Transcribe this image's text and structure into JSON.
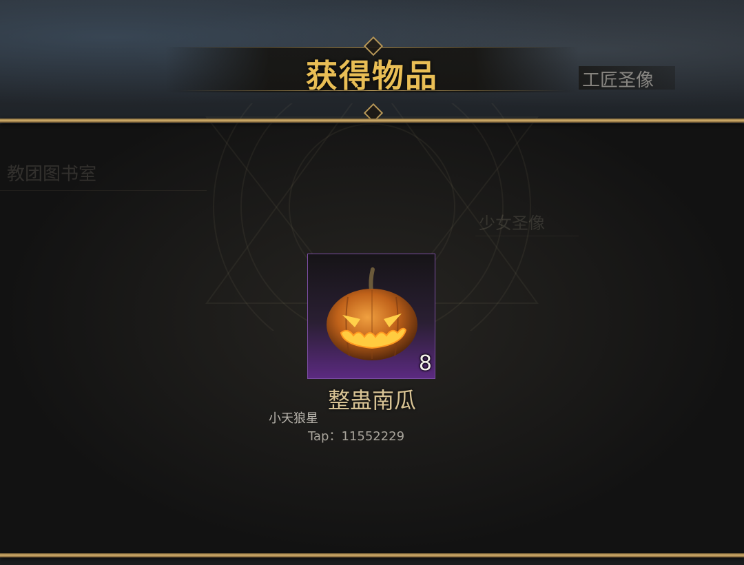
{
  "header": {
    "title": "获得物品",
    "side_label": "工匠圣像"
  },
  "background_labels": {
    "left": "教团图书室",
    "center_right": "少女圣像"
  },
  "reward_item": {
    "icon": "jack-o-lantern-icon",
    "name": "整蛊南瓜",
    "count": "8",
    "rarity_color": "#5b2a80"
  },
  "watermark": {
    "user": "小天狼星",
    "tap_id": "Tap：11552229"
  },
  "colors": {
    "title_gold": "#e9be55",
    "divider_gold": "#d6b26c",
    "item_name": "#d8c394"
  }
}
